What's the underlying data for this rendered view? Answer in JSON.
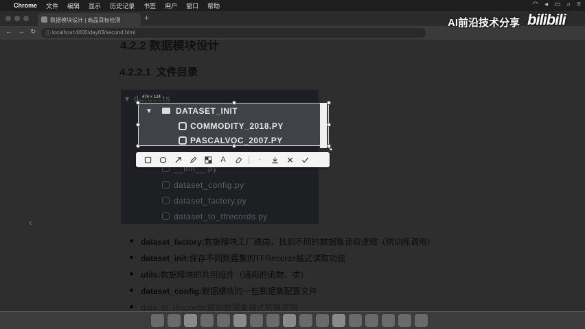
{
  "menubar": {
    "items": [
      "Chrome",
      "文件",
      "编辑",
      "显示",
      "历史记录",
      "书签",
      "用户",
      "窗口",
      "帮助"
    ]
  },
  "browser": {
    "tab_title": "数据模块设计 | 商品目标检测",
    "url": "localhost:4000/day03/second.html"
  },
  "watermark": {
    "text": "AI前沿技术分享",
    "logo": "bilibili"
  },
  "document": {
    "heading_cut": "4.2.2 数据模块设计",
    "section_number": "4.2.2.1",
    "section_title": "文件目录",
    "tree": {
      "root": "datasets",
      "selected_folder": "DATASET_INIT",
      "selected_files": [
        "COMMODITY_2018.PY",
        "PASCALVOC_2007.PY"
      ],
      "other_files": [
        "__init__.py",
        "dataset_config.py",
        "dataset_factory.py",
        "dataset_to_tfrecords.py"
      ]
    },
    "selection_size": "474 × 124",
    "bullets": [
      {
        "key": "dataset_factory:",
        "text": "数据模块工厂路由，找到不同的数据集读取逻辑（供训练调用）"
      },
      {
        "key": "dataset_init:",
        "text": "保存不同数据集的TFRecords格式读取功能"
      },
      {
        "key": "utils:",
        "text": "数据模块的共用组件（通用的函数、类）"
      },
      {
        "key": "dataset_config:",
        "text": "数据模块的一些数据集配置文件"
      },
      {
        "key": "data_to_tfrecords:",
        "text": "原始数据集格式转换逻辑"
      }
    ]
  },
  "toolbar": {
    "tools": [
      "rectangle-icon",
      "ellipse-icon",
      "arrow-icon",
      "pen-icon",
      "mosaic-icon",
      "text-icon",
      "eraser-icon",
      "undo-icon",
      "download-icon",
      "close-icon",
      "confirm-icon"
    ]
  }
}
